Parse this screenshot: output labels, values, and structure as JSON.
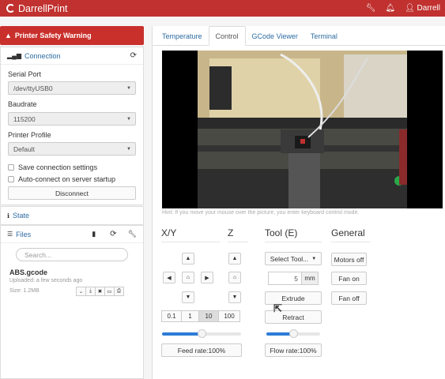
{
  "navbar": {
    "brand": "DarrellPrint",
    "user": "Darrell"
  },
  "sidebar": {
    "warning": "Printer Safety Warning",
    "connection": {
      "title": "Connection",
      "serial_port_label": "Serial Port",
      "serial_port_value": "/dev/ttyUSB0",
      "baudrate_label": "Baudrate",
      "baudrate_value": "115200",
      "profile_label": "Printer Profile",
      "profile_value": "Default",
      "save_settings": "Save connection settings",
      "auto_connect": "Auto-connect on server startup",
      "disconnect": "Disconnect"
    },
    "state": {
      "title": "State"
    },
    "files": {
      "title": "Files",
      "search_placeholder": "Search...",
      "file_name": "ABS.gcode",
      "uploaded": "Uploaded: a few seconds ago",
      "size": "Size: 1.2MB"
    }
  },
  "tabs": [
    {
      "label": "Temperature",
      "active": false
    },
    {
      "label": "Control",
      "active": true
    },
    {
      "label": "GCode Viewer",
      "active": false
    },
    {
      "label": "Terminal",
      "active": false
    }
  ],
  "control": {
    "hint": "Hint: If you move your mouse over the picture, you enter keyboard control mode.",
    "headings": {
      "xy": "X/Y",
      "z": "Z",
      "tool": "Tool (E)",
      "general": "General"
    },
    "steps": [
      "0.1",
      "1",
      "10",
      "100"
    ],
    "active_step": "10",
    "feed_rate": "Feed rate:100%",
    "feed_rate_level": 0.5,
    "flow_rate": "Flow rate:100%",
    "flow_rate_level": 0.5,
    "select_tool": "Select Tool...",
    "extrude_amount": "5",
    "extrude_unit": "mm",
    "extrude": "Extrude",
    "retract": "Retract",
    "motors_off": "Motors off",
    "fan_on": "Fan on",
    "fan_off": "Fan off"
  },
  "colors": {
    "brand": "#c0312f",
    "link": "#2d6ca2",
    "slider": "#2d7cd6"
  }
}
